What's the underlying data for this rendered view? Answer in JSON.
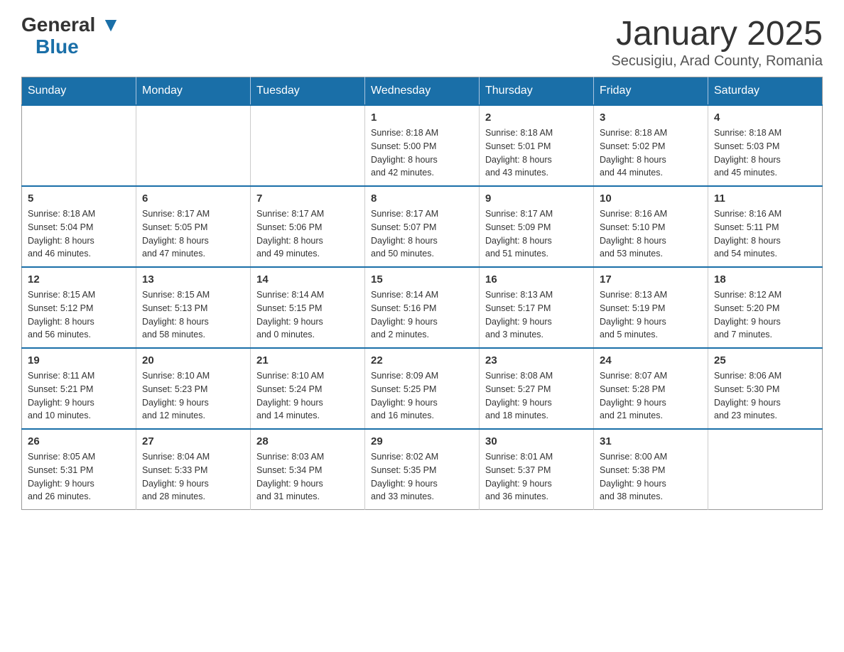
{
  "logo": {
    "general": "General",
    "blue": "Blue"
  },
  "title": "January 2025",
  "subtitle": "Secusigiu, Arad County, Romania",
  "days_of_week": [
    "Sunday",
    "Monday",
    "Tuesday",
    "Wednesday",
    "Thursday",
    "Friday",
    "Saturday"
  ],
  "weeks": [
    [
      {
        "day": "",
        "info": ""
      },
      {
        "day": "",
        "info": ""
      },
      {
        "day": "",
        "info": ""
      },
      {
        "day": "1",
        "info": "Sunrise: 8:18 AM\nSunset: 5:00 PM\nDaylight: 8 hours\nand 42 minutes."
      },
      {
        "day": "2",
        "info": "Sunrise: 8:18 AM\nSunset: 5:01 PM\nDaylight: 8 hours\nand 43 minutes."
      },
      {
        "day": "3",
        "info": "Sunrise: 8:18 AM\nSunset: 5:02 PM\nDaylight: 8 hours\nand 44 minutes."
      },
      {
        "day": "4",
        "info": "Sunrise: 8:18 AM\nSunset: 5:03 PM\nDaylight: 8 hours\nand 45 minutes."
      }
    ],
    [
      {
        "day": "5",
        "info": "Sunrise: 8:18 AM\nSunset: 5:04 PM\nDaylight: 8 hours\nand 46 minutes."
      },
      {
        "day": "6",
        "info": "Sunrise: 8:17 AM\nSunset: 5:05 PM\nDaylight: 8 hours\nand 47 minutes."
      },
      {
        "day": "7",
        "info": "Sunrise: 8:17 AM\nSunset: 5:06 PM\nDaylight: 8 hours\nand 49 minutes."
      },
      {
        "day": "8",
        "info": "Sunrise: 8:17 AM\nSunset: 5:07 PM\nDaylight: 8 hours\nand 50 minutes."
      },
      {
        "day": "9",
        "info": "Sunrise: 8:17 AM\nSunset: 5:09 PM\nDaylight: 8 hours\nand 51 minutes."
      },
      {
        "day": "10",
        "info": "Sunrise: 8:16 AM\nSunset: 5:10 PM\nDaylight: 8 hours\nand 53 minutes."
      },
      {
        "day": "11",
        "info": "Sunrise: 8:16 AM\nSunset: 5:11 PM\nDaylight: 8 hours\nand 54 minutes."
      }
    ],
    [
      {
        "day": "12",
        "info": "Sunrise: 8:15 AM\nSunset: 5:12 PM\nDaylight: 8 hours\nand 56 minutes."
      },
      {
        "day": "13",
        "info": "Sunrise: 8:15 AM\nSunset: 5:13 PM\nDaylight: 8 hours\nand 58 minutes."
      },
      {
        "day": "14",
        "info": "Sunrise: 8:14 AM\nSunset: 5:15 PM\nDaylight: 9 hours\nand 0 minutes."
      },
      {
        "day": "15",
        "info": "Sunrise: 8:14 AM\nSunset: 5:16 PM\nDaylight: 9 hours\nand 2 minutes."
      },
      {
        "day": "16",
        "info": "Sunrise: 8:13 AM\nSunset: 5:17 PM\nDaylight: 9 hours\nand 3 minutes."
      },
      {
        "day": "17",
        "info": "Sunrise: 8:13 AM\nSunset: 5:19 PM\nDaylight: 9 hours\nand 5 minutes."
      },
      {
        "day": "18",
        "info": "Sunrise: 8:12 AM\nSunset: 5:20 PM\nDaylight: 9 hours\nand 7 minutes."
      }
    ],
    [
      {
        "day": "19",
        "info": "Sunrise: 8:11 AM\nSunset: 5:21 PM\nDaylight: 9 hours\nand 10 minutes."
      },
      {
        "day": "20",
        "info": "Sunrise: 8:10 AM\nSunset: 5:23 PM\nDaylight: 9 hours\nand 12 minutes."
      },
      {
        "day": "21",
        "info": "Sunrise: 8:10 AM\nSunset: 5:24 PM\nDaylight: 9 hours\nand 14 minutes."
      },
      {
        "day": "22",
        "info": "Sunrise: 8:09 AM\nSunset: 5:25 PM\nDaylight: 9 hours\nand 16 minutes."
      },
      {
        "day": "23",
        "info": "Sunrise: 8:08 AM\nSunset: 5:27 PM\nDaylight: 9 hours\nand 18 minutes."
      },
      {
        "day": "24",
        "info": "Sunrise: 8:07 AM\nSunset: 5:28 PM\nDaylight: 9 hours\nand 21 minutes."
      },
      {
        "day": "25",
        "info": "Sunrise: 8:06 AM\nSunset: 5:30 PM\nDaylight: 9 hours\nand 23 minutes."
      }
    ],
    [
      {
        "day": "26",
        "info": "Sunrise: 8:05 AM\nSunset: 5:31 PM\nDaylight: 9 hours\nand 26 minutes."
      },
      {
        "day": "27",
        "info": "Sunrise: 8:04 AM\nSunset: 5:33 PM\nDaylight: 9 hours\nand 28 minutes."
      },
      {
        "day": "28",
        "info": "Sunrise: 8:03 AM\nSunset: 5:34 PM\nDaylight: 9 hours\nand 31 minutes."
      },
      {
        "day": "29",
        "info": "Sunrise: 8:02 AM\nSunset: 5:35 PM\nDaylight: 9 hours\nand 33 minutes."
      },
      {
        "day": "30",
        "info": "Sunrise: 8:01 AM\nSunset: 5:37 PM\nDaylight: 9 hours\nand 36 minutes."
      },
      {
        "day": "31",
        "info": "Sunrise: 8:00 AM\nSunset: 5:38 PM\nDaylight: 9 hours\nand 38 minutes."
      },
      {
        "day": "",
        "info": ""
      }
    ]
  ]
}
